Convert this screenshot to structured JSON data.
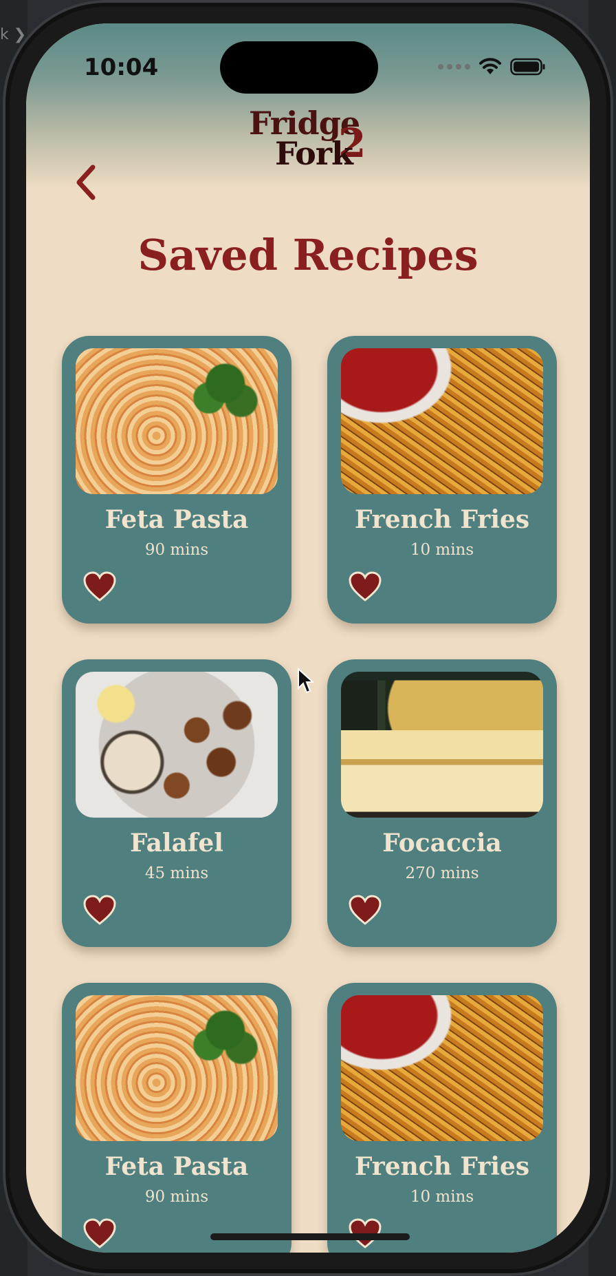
{
  "status_bar": {
    "time": "10:04"
  },
  "header": {
    "logo_line1": "Fridge",
    "logo_line2": "Fork",
    "logo_two": "2"
  },
  "page": {
    "title": "Saved Recipes"
  },
  "colors": {
    "background": "#eedcc4",
    "card": "#4f7f7e",
    "title": "#8a1f1f",
    "heart": "#7e1b1b",
    "card_text": "#f1e4cf"
  },
  "recipes": [
    {
      "name": "Feta Pasta",
      "time": "90 mins",
      "image": "feta-pasta-image",
      "saved": true
    },
    {
      "name": "French Fries",
      "time": "10 mins",
      "image": "french-fries-image",
      "saved": true
    },
    {
      "name": "Falafel",
      "time": "45 mins",
      "image": "falafel-image",
      "saved": true
    },
    {
      "name": "Focaccia",
      "time": "270 mins",
      "image": "focaccia-image",
      "saved": true
    },
    {
      "name": "Feta Pasta",
      "time": "90 mins",
      "image": "feta-pasta-image",
      "saved": true
    },
    {
      "name": "French Fries",
      "time": "10 mins",
      "image": "french-fries-image",
      "saved": true
    }
  ],
  "icons": {
    "back": "chevron-left-icon",
    "favorite": "heart-icon",
    "wifi": "wifi-icon",
    "battery": "battery-icon"
  }
}
